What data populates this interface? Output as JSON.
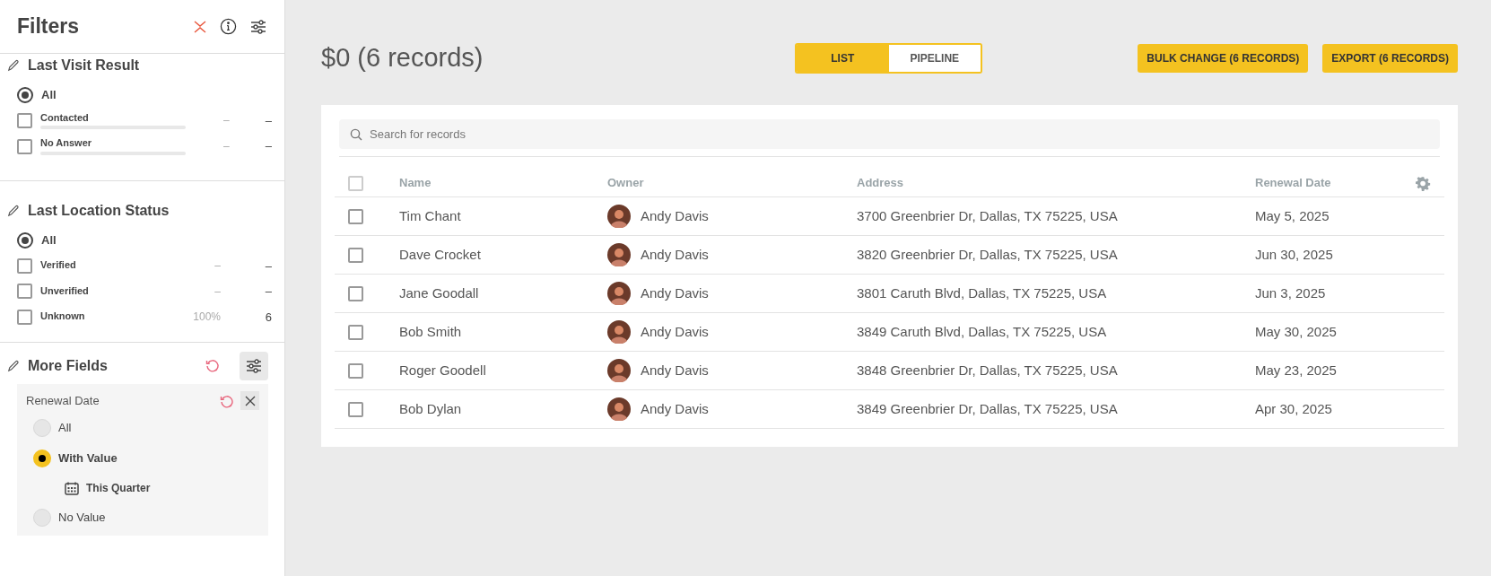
{
  "sidebar": {
    "title": "Filters",
    "sections": [
      {
        "title": "Last Visit Result",
        "options": [
          {
            "label": "All",
            "kind": "radio",
            "selected": true
          },
          {
            "label": "Contacted",
            "kind": "checkbox",
            "checked": false,
            "level": 0,
            "percent": "–",
            "count": "–"
          },
          {
            "label": "No Answer",
            "kind": "checkbox",
            "checked": false,
            "level": 0,
            "percent": "–",
            "count": "–"
          }
        ]
      },
      {
        "title": "Last Location Status",
        "options": [
          {
            "label": "All",
            "kind": "radio",
            "selected": true
          },
          {
            "label": "Verified",
            "kind": "checkbox",
            "checked": false,
            "percent": "–",
            "count": "–"
          },
          {
            "label": "Unverified",
            "kind": "checkbox",
            "checked": false,
            "percent": "–",
            "count": "–"
          },
          {
            "label": "Unknown",
            "kind": "checkbox",
            "checked": false,
            "percent": "100%",
            "count": "6"
          }
        ]
      }
    ],
    "more_fields": {
      "title": "More Fields",
      "field": {
        "label": "Renewal Date",
        "options": [
          {
            "label": "All",
            "selected": false
          },
          {
            "label": "With Value",
            "selected": true,
            "sub": "This Quarter"
          },
          {
            "label": "No Value",
            "selected": false
          }
        ]
      }
    }
  },
  "main": {
    "title": "$0 (6 records)",
    "view_tabs": [
      {
        "label": "LIST",
        "selected": true
      },
      {
        "label": "PIPELINE",
        "selected": false
      }
    ],
    "actions": [
      "BULK CHANGE (6 RECORDS)",
      "EXPORT (6 RECORDS)"
    ],
    "search": {
      "placeholder": "Search for records"
    },
    "table": {
      "all_checked": false,
      "columns": [
        "Name",
        "Owner",
        "Address",
        "Renewal Date"
      ],
      "rows": [
        {
          "checked": false,
          "name": "Tim Chant",
          "owner": "Andy Davis",
          "address": "3700 Greenbrier Dr, Dallas, TX 75225, USA",
          "renewal_date": "May 5, 2025"
        },
        {
          "checked": false,
          "name": "Dave Crocket",
          "owner": "Andy Davis",
          "address": "3820 Greenbrier Dr, Dallas, TX 75225, USA",
          "renewal_date": "Jun 30, 2025"
        },
        {
          "checked": false,
          "name": "Jane Goodall",
          "owner": "Andy Davis",
          "address": "3801 Caruth Blvd, Dallas, TX 75225, USA",
          "renewal_date": "Jun 3, 2025"
        },
        {
          "checked": false,
          "name": "Bob Smith",
          "owner": "Andy Davis",
          "address": "3849 Caruth Blvd, Dallas, TX 75225, USA",
          "renewal_date": "May 30, 2025"
        },
        {
          "checked": false,
          "name": "Roger Goodell",
          "owner": "Andy Davis",
          "address": "3848 Greenbrier Dr, Dallas, TX 75225, USA",
          "renewal_date": "May 23, 2025"
        },
        {
          "checked": false,
          "name": "Bob Dylan",
          "owner": "Andy Davis",
          "address": "3849 Greenbrier Dr, Dallas, TX 75225, USA",
          "renewal_date": "Apr 30, 2025"
        }
      ]
    }
  }
}
